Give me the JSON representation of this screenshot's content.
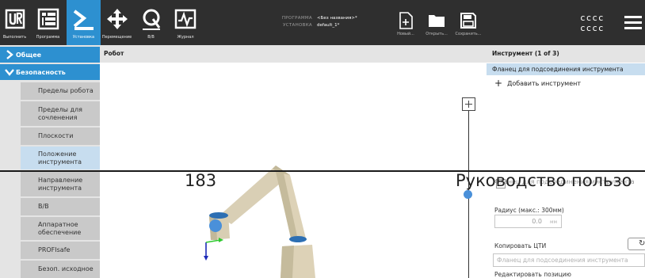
{
  "toolbar": {
    "tabs": [
      {
        "label": "Выполнить",
        "icon": "ur-logo-icon"
      },
      {
        "label": "Программа",
        "icon": "program-icon"
      },
      {
        "label": "Установка",
        "icon": "installation-icon",
        "active": true
      },
      {
        "label": "Перемещение",
        "icon": "move-icon"
      },
      {
        "label": "В/В",
        "icon": "io-icon"
      },
      {
        "label": "Журнал",
        "icon": "log-icon"
      }
    ],
    "program_label": "ПРОГРАММА",
    "program_value": "<Без названия>*",
    "installation_label": "УСТАНОВКА",
    "installation_value": "default_1*",
    "file_buttons": [
      {
        "label": "Новый...",
        "icon": "new-file-icon"
      },
      {
        "label": "Открыть...",
        "icon": "folder-icon"
      },
      {
        "label": "Сохранить...",
        "icon": "save-icon"
      }
    ],
    "status_line1": "cccc",
    "status_line2": "cccc",
    "accent_color": "#2d90d0",
    "bg_color": "#2f2f2f"
  },
  "sidebar": {
    "general_label": "Общее",
    "safety_label": "Безопасность",
    "items": [
      "Пределы робота",
      "Пределы для сочленения",
      "Плоскости",
      "Положение инструмента",
      "Направление инструмента",
      "В/В",
      "Аппаратное обеспечение",
      "PROFIsafe",
      "Безоп. исходное"
    ],
    "selected_item": "Положение инструмента"
  },
  "canvas": {
    "title": "Робот"
  },
  "right_panel": {
    "title": "Инструмент (1 of 3)",
    "selected_tool": "Фланец для подсоединения инструмента",
    "add_tool_label": "Добавить инструмент",
    "checkbox_label": "Фланец для подсоединения инструмента",
    "radius_label": "Радиус (макс.: 300мм)",
    "radius_value": "0.0",
    "radius_unit": "мм",
    "copy_tcp_label": "Копировать ЦТИ",
    "copy_tcp_placeholder": "Фланец для подсоединения инструмента",
    "edit_position_label": "Редактировать позицию"
  },
  "overlay": {
    "page_number": "183",
    "page_title": "Руководство пользо"
  }
}
